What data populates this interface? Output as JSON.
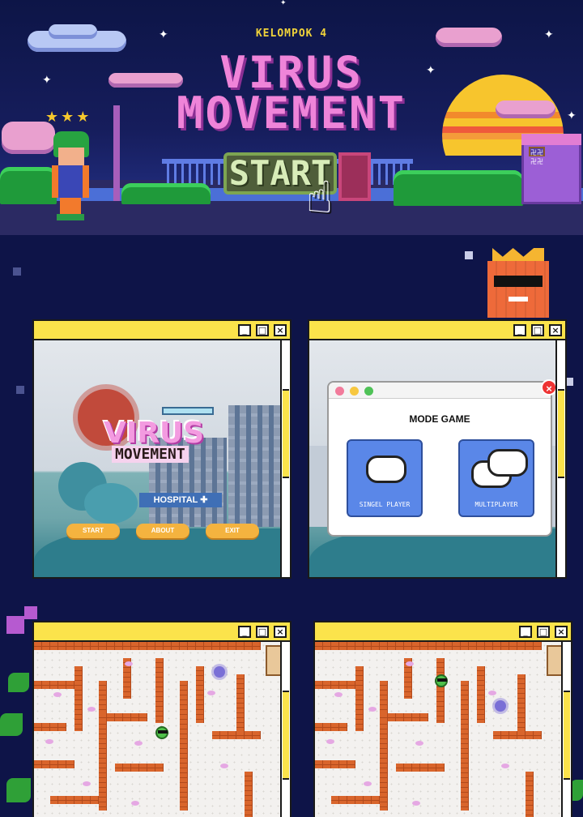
{
  "banner": {
    "group": "KELOMPOK 4",
    "title_line1": "VIRUS",
    "title_line2": "MOVEMENT",
    "start_label": "START",
    "shop_sign": "卍卍卍卍"
  },
  "window_controls": {
    "minimize": "_",
    "maximize": "□",
    "close": "×"
  },
  "menu_screen": {
    "logo_line1": "VIRUS",
    "logo_line2": "MOVEMENT",
    "hospital_label": "HOSPITAL ✚",
    "buttons": [
      "START",
      "ABOUT",
      "EXIT"
    ]
  },
  "mode_screen": {
    "title": "MODE GAME",
    "single_label": "SINGEL PLAYER",
    "multi_label": "MULTIPLAYER",
    "close_label": "×"
  },
  "colors": {
    "background": "#0e1448",
    "window_yellow": "#fbe34b",
    "title_pink": "#ef84d9",
    "maze_brick": "#d9652c",
    "mode_blue": "#5a87e8"
  }
}
